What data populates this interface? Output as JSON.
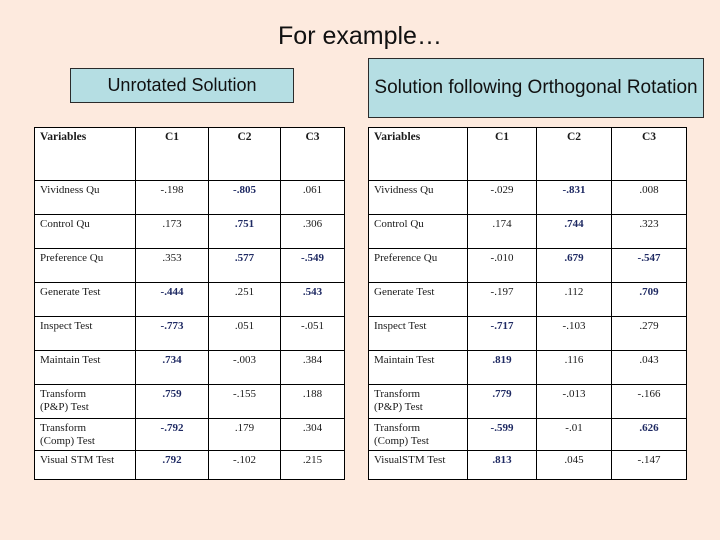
{
  "slide": {
    "title": "For example…",
    "background_color": "#fdeade",
    "caption_fill_color": "#b5dee3",
    "highlight_color": "#1f2a63"
  },
  "captions": {
    "left": "Unrotated Solution",
    "right": "Solution following Orthogonal Rotation"
  },
  "tables": {
    "left": {
      "name": "unrotated-solution-table",
      "columns": [
        "Variables",
        "C1",
        "C2",
        "C3"
      ],
      "rows": [
        {
          "variable": "Vividness Qu",
          "values": [
            "-.198",
            "-.805",
            ".061"
          ],
          "bold": [
            false,
            true,
            false
          ]
        },
        {
          "variable": "Control Qu",
          "values": [
            ".173",
            ".751",
            ".306"
          ],
          "bold": [
            false,
            true,
            false
          ]
        },
        {
          "variable": "Preference Qu",
          "values": [
            ".353",
            ".577",
            "-.549"
          ],
          "bold": [
            false,
            true,
            true
          ]
        },
        {
          "variable": "Generate Test",
          "values": [
            "-.444",
            ".251",
            ".543"
          ],
          "bold": [
            true,
            false,
            true
          ]
        },
        {
          "variable": "Inspect Test",
          "values": [
            "-.773",
            ".051",
            "-.051"
          ],
          "bold": [
            true,
            false,
            false
          ]
        },
        {
          "variable": "Maintain Test",
          "values": [
            ".734",
            "-.003",
            ".384"
          ],
          "bold": [
            true,
            false,
            false
          ]
        },
        {
          "variable": "Transform\n      (P&P) Test",
          "values": [
            ".759",
            "-.155",
            ".188"
          ],
          "bold": [
            true,
            false,
            false
          ]
        },
        {
          "variable": "Transform\n(Comp) Test",
          "values": [
            "-.792",
            ".179",
            ".304"
          ],
          "bold": [
            true,
            false,
            false
          ]
        },
        {
          "variable": "Visual STM Test",
          "values": [
            ".792",
            "-.102",
            ".215"
          ],
          "bold": [
            true,
            false,
            false
          ]
        }
      ]
    },
    "right": {
      "name": "rotated-solution-table",
      "columns": [
        "Variables",
        "C1",
        "C2",
        "C3"
      ],
      "rows": [
        {
          "variable": "Vividness Qu",
          "values": [
            "-.029",
            "-.831",
            ".008"
          ],
          "bold": [
            false,
            true,
            false
          ]
        },
        {
          "variable": "Control Qu",
          "values": [
            ".174",
            ".744",
            ".323"
          ],
          "bold": [
            false,
            true,
            false
          ]
        },
        {
          "variable": "Preference Qu",
          "values": [
            "-.010",
            ".679",
            "-.547"
          ],
          "bold": [
            false,
            true,
            true
          ]
        },
        {
          "variable": "Generate Test",
          "values": [
            "-.197",
            ".112",
            ".709"
          ],
          "bold": [
            false,
            false,
            true
          ]
        },
        {
          "variable": "Inspect Test",
          "values": [
            "-.717",
            "-.103",
            ".279"
          ],
          "bold": [
            true,
            false,
            false
          ]
        },
        {
          "variable": "Maintain Test",
          "values": [
            ".819",
            ".116",
            ".043"
          ],
          "bold": [
            true,
            false,
            false
          ]
        },
        {
          "variable": "Transform\n      (P&P) Test",
          "values": [
            ".779",
            "-.013",
            "-.166"
          ],
          "bold": [
            true,
            false,
            false
          ]
        },
        {
          "variable": "Transform\n(Comp) Test",
          "values": [
            "-.599",
            "-.01",
            ".626"
          ],
          "bold": [
            true,
            false,
            true
          ]
        },
        {
          "variable": "  VisualSTM Test",
          "values": [
            ".813",
            ".045",
            "-.147"
          ],
          "bold": [
            true,
            false,
            false
          ]
        }
      ]
    }
  }
}
